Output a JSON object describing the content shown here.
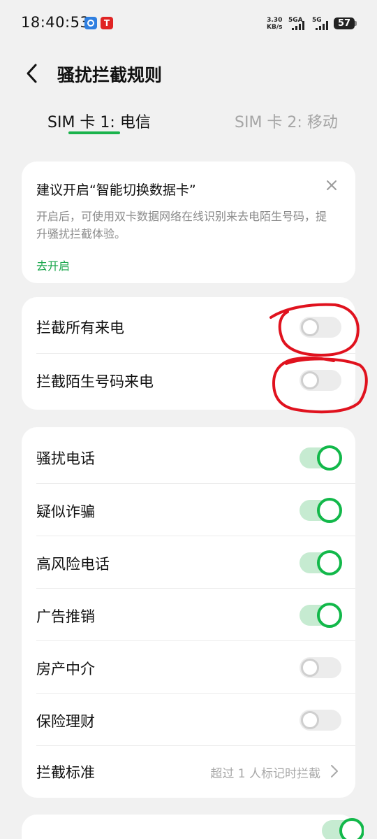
{
  "status_bar": {
    "time": "18:40:53",
    "app_icon_b_glyph": "T",
    "speed_value": "3.30",
    "speed_unit": "KB/s",
    "sim1_network": "5GA",
    "sim2_network": "5G",
    "battery": "57"
  },
  "header": {
    "title": "骚扰拦截规则"
  },
  "tabs": [
    {
      "label": "SIM 卡 1: 电信",
      "selected": true
    },
    {
      "label": "SIM 卡 2: 移动",
      "selected": false
    }
  ],
  "tip": {
    "title": "建议开启“智能切换数据卡”",
    "description": "开启后，可使用双卡数据网络在线识别来去电陌生号码，提升骚扰拦截体验。",
    "action": "去开启"
  },
  "block_card": {
    "items": [
      {
        "label": "拦截所有来电",
        "on": false
      },
      {
        "label": "拦截陌生号码来电",
        "on": false
      }
    ]
  },
  "category_card": {
    "items": [
      {
        "label": "骚扰电话",
        "on": true
      },
      {
        "label": "疑似诈骗",
        "on": true
      },
      {
        "label": "高风险电话",
        "on": true
      },
      {
        "label": "广告推销",
        "on": true
      },
      {
        "label": "房产中介",
        "on": false
      },
      {
        "label": "保险理财",
        "on": false
      }
    ],
    "criteria": {
      "label": "拦截标准",
      "value": "超过 1 人标记时拦截"
    }
  },
  "colors": {
    "accent": "#12b84a",
    "annotation": "#e0121e",
    "background": "#f1f1f1"
  },
  "icons": {
    "back": "chevron-left-icon",
    "close": "close-icon",
    "criteria": "chevron-right-icon"
  }
}
